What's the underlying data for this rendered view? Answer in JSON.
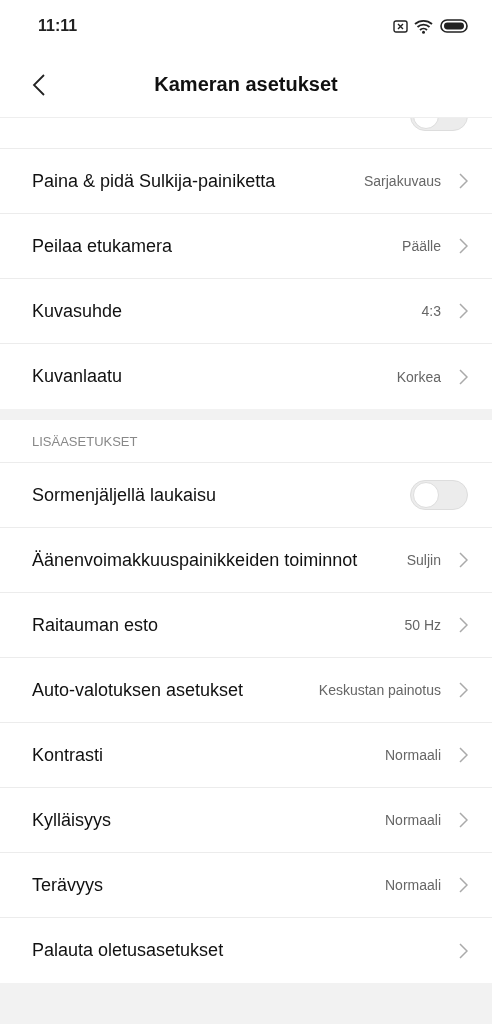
{
  "status_bar": {
    "time": "11:11"
  },
  "header": {
    "title": "Kameran asetukset"
  },
  "groups": [
    {
      "partial_item": {
        "kind": "toggle",
        "on": false
      },
      "items": [
        {
          "kind": "link",
          "label": "Paina & pidä Sulkija-painiketta",
          "value": "Sarjakuvaus"
        },
        {
          "kind": "link",
          "label": "Peilaa etukamera",
          "value": "Päälle"
        },
        {
          "kind": "link",
          "label": "Kuvasuhde",
          "value": "4:3"
        },
        {
          "kind": "link",
          "label": "Kuvanlaatu",
          "value": "Korkea"
        }
      ]
    },
    {
      "title": "LISÄASETUKSET",
      "items": [
        {
          "kind": "toggle",
          "label": "Sormenjäljellä laukaisu",
          "on": false
        },
        {
          "kind": "link",
          "label": "Äänenvoimakkuuspainikkeiden toiminnot",
          "value": "Suljin"
        },
        {
          "kind": "link",
          "label": "Raitauman esto",
          "value": "50 Hz"
        },
        {
          "kind": "link",
          "label": "Auto-valotuksen asetukset",
          "value": "Keskustan painotus"
        },
        {
          "kind": "link",
          "label": "Kontrasti",
          "value": "Normaali"
        },
        {
          "kind": "link",
          "label": "Kylläisyys",
          "value": "Normaali"
        },
        {
          "kind": "link",
          "label": "Terävyys",
          "value": "Normaali"
        },
        {
          "kind": "link",
          "label": "Palauta oletusasetukset"
        }
      ]
    }
  ]
}
